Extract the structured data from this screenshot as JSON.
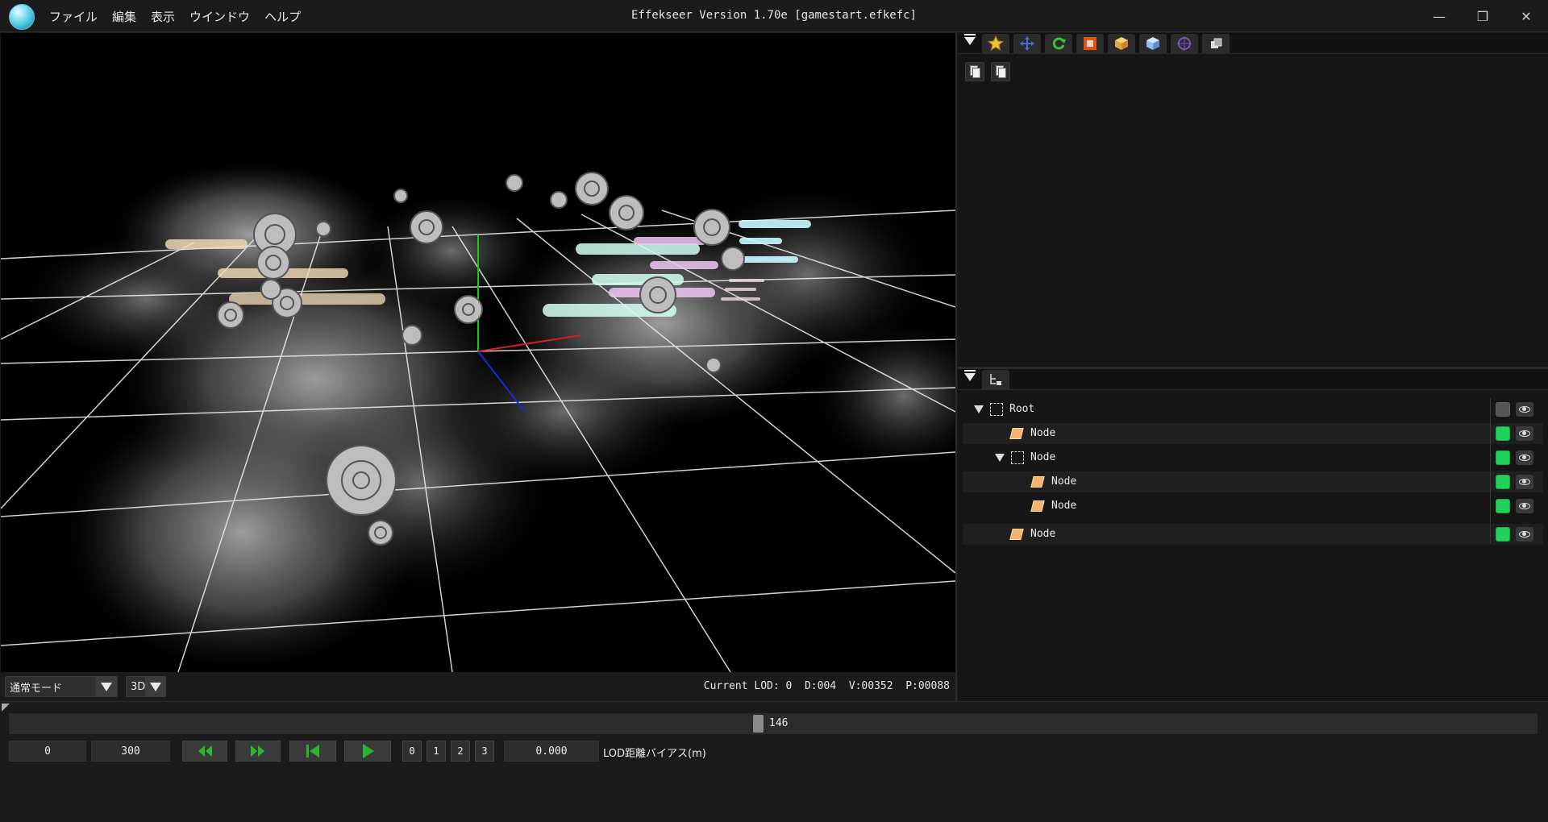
{
  "titlebar": {
    "menu": [
      "ファイル",
      "編集",
      "表示",
      "ウインドウ",
      "ヘルプ"
    ],
    "title": "Effekseer Version 1.70e [gamestart.efkefc]",
    "controls": {
      "minimize": "—",
      "restore": "❐",
      "close": "✕"
    }
  },
  "viewport": {
    "mode_select": "通常モード",
    "dimension_select": "3D",
    "status": "Current LOD: 0  D:004  V:00352  P:00088"
  },
  "toolbar_top": {
    "icons": [
      "panel-menu-icon",
      "star-icon",
      "move-icon",
      "refresh-icon",
      "stop-box-icon",
      "box-icon",
      "cube-icon",
      "target-icon",
      "layers-icon"
    ]
  },
  "props": {
    "copy_icon": "copy-icon",
    "paste_icon": "paste-icon"
  },
  "tree": {
    "rows": [
      {
        "label": "Root",
        "type": "null",
        "expanded": true,
        "visible": false
      },
      {
        "label": "Node",
        "type": "sprite",
        "visible": true
      },
      {
        "label": "Node",
        "type": "null",
        "expanded": true,
        "visible": true
      },
      {
        "label": "Node",
        "type": "sprite",
        "visible": true
      },
      {
        "label": "Node",
        "type": "sprite",
        "visible": true
      },
      {
        "label": "Node",
        "type": "sprite",
        "visible": true
      }
    ]
  },
  "timeline": {
    "current_frame": "146",
    "progress": 0.487,
    "start_frame": "0",
    "end_frame": "300",
    "lod_levels": [
      "0",
      "1",
      "2",
      "3"
    ],
    "lod_bias_value": "0.000",
    "lod_bias_label": "LOD距離バイアス(m)"
  },
  "colors": {
    "accent_green": "#1fd25a",
    "background": "#1b1b1b",
    "sprite_icon": "#f4b46e"
  }
}
